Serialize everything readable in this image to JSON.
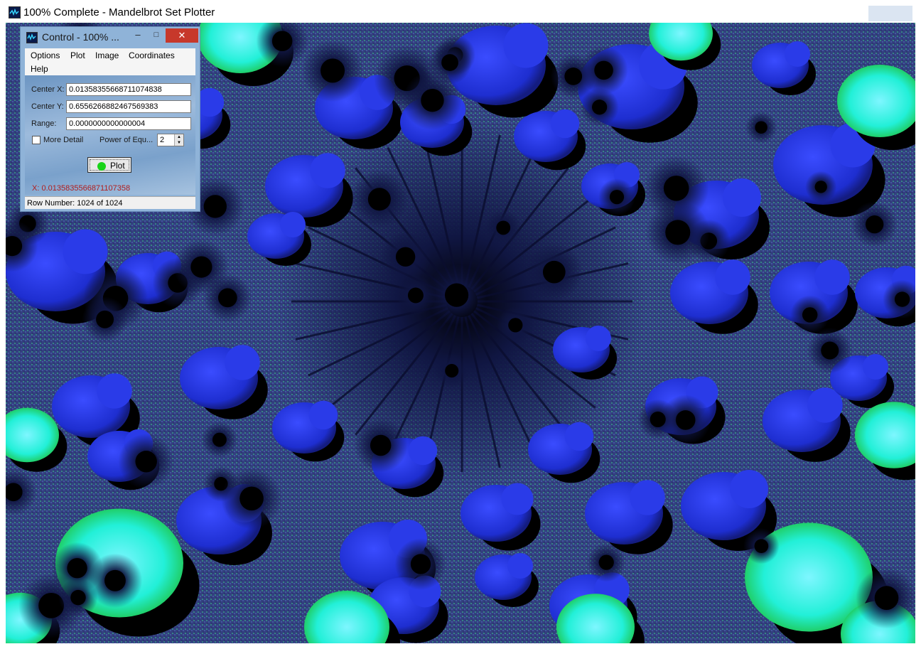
{
  "main_window": {
    "title": "100% Complete - Mandelbrot Set Plotter"
  },
  "control_window": {
    "title": "Control - 100% ...",
    "min_glyph": "–",
    "max_glyph": "□",
    "close_glyph": "✕",
    "menu": [
      "Options",
      "Plot",
      "Image",
      "Coordinates",
      "Help"
    ],
    "center_x_label": "Center X:",
    "center_x_value": "0.0135835566871107483​8",
    "center_y_label": "Center Y:",
    "center_y_value": "0.6556266882467569383",
    "range_label": "Range:",
    "range_value": "0.0000000000000004",
    "more_detail_label": "More Detail",
    "power_label": "Power of Equ...",
    "power_value": "2",
    "plot_button": "Plot",
    "x_readout_label": "X:",
    "x_readout_value": "0.0135835566871107358",
    "status": "Row Number: 1024 of 1024"
  },
  "colors": {
    "close_button": "#c7382b",
    "fractal_dark": "#000000",
    "fractal_blue": "#1e2ee0",
    "fractal_cyan": "#22f0d8",
    "fractal_green": "#2af36a",
    "x_readout": "#b01d1d"
  },
  "icons": [
    "app-icon",
    "control-app-icon",
    "minimize-icon",
    "maximize-icon",
    "close-icon",
    "plot-dot-icon",
    "spin-up-icon",
    "spin-down-icon"
  ]
}
